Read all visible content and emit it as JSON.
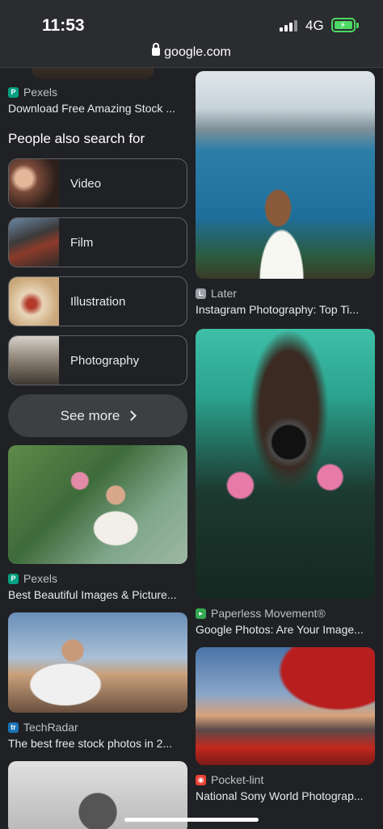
{
  "status": {
    "time": "11:53",
    "network": "4G"
  },
  "browser": {
    "url": "google.com"
  },
  "left": {
    "top_result": {
      "source": "Pexels",
      "title": "Download Free Amazing Stock ..."
    },
    "pasf": {
      "heading": "People also search for",
      "items": [
        {
          "label": "Video"
        },
        {
          "label": "Film"
        },
        {
          "label": "Illustration"
        },
        {
          "label": "Photography"
        }
      ],
      "see_more": "See more"
    },
    "result2": {
      "source": "Pexels",
      "title": "Best Beautiful Images & Picture..."
    },
    "result3": {
      "source": "TechRadar",
      "title": "The best free stock photos in 2..."
    }
  },
  "right": {
    "result1": {
      "source": "Later",
      "title": "Instagram Photography: Top Ti..."
    },
    "result2": {
      "source": "Paperless Movement®",
      "title": "Google Photos: Are Your Image..."
    },
    "result3": {
      "source": "Pocket-lint",
      "title": "National Sony World Photograp..."
    }
  },
  "colors": {
    "background": "#202124",
    "chip_border": "#5f6368",
    "pexels": "#05a081",
    "later": "#9aa0a6",
    "paperless": "#34a853",
    "techradar": "#1a73b8",
    "pocketlint": "#ea4335"
  },
  "icons": [
    "lock-icon",
    "chevron-right-icon",
    "battery-icon",
    "signal-icon"
  ]
}
